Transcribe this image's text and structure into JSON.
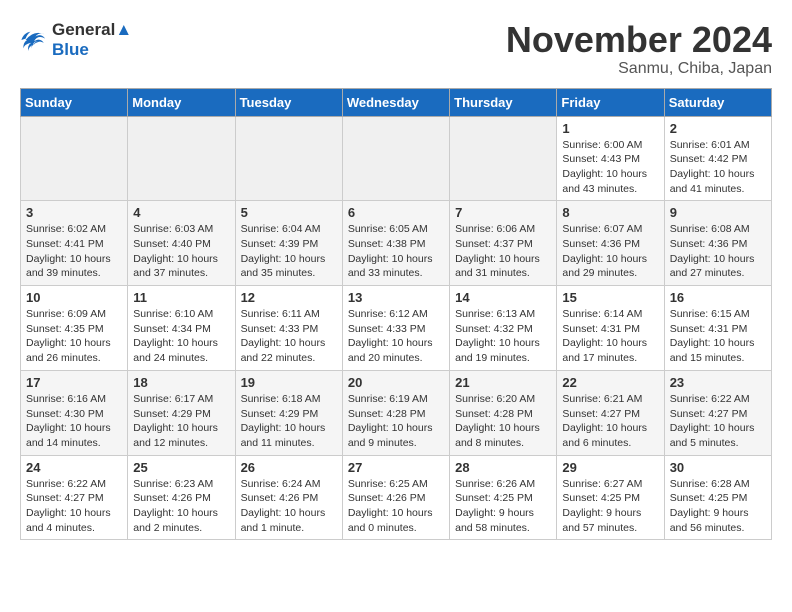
{
  "logo": {
    "line1": "General",
    "line2": "Blue"
  },
  "title": "November 2024",
  "location": "Sanmu, Chiba, Japan",
  "weekdays": [
    "Sunday",
    "Monday",
    "Tuesday",
    "Wednesday",
    "Thursday",
    "Friday",
    "Saturday"
  ],
  "weeks": [
    [
      {
        "day": "",
        "empty": true
      },
      {
        "day": "",
        "empty": true
      },
      {
        "day": "",
        "empty": true
      },
      {
        "day": "",
        "empty": true
      },
      {
        "day": "",
        "empty": true
      },
      {
        "day": "1",
        "sunrise": "Sunrise: 6:00 AM",
        "sunset": "Sunset: 4:43 PM",
        "daylight": "Daylight: 10 hours and 43 minutes."
      },
      {
        "day": "2",
        "sunrise": "Sunrise: 6:01 AM",
        "sunset": "Sunset: 4:42 PM",
        "daylight": "Daylight: 10 hours and 41 minutes."
      }
    ],
    [
      {
        "day": "3",
        "sunrise": "Sunrise: 6:02 AM",
        "sunset": "Sunset: 4:41 PM",
        "daylight": "Daylight: 10 hours and 39 minutes."
      },
      {
        "day": "4",
        "sunrise": "Sunrise: 6:03 AM",
        "sunset": "Sunset: 4:40 PM",
        "daylight": "Daylight: 10 hours and 37 minutes."
      },
      {
        "day": "5",
        "sunrise": "Sunrise: 6:04 AM",
        "sunset": "Sunset: 4:39 PM",
        "daylight": "Daylight: 10 hours and 35 minutes."
      },
      {
        "day": "6",
        "sunrise": "Sunrise: 6:05 AM",
        "sunset": "Sunset: 4:38 PM",
        "daylight": "Daylight: 10 hours and 33 minutes."
      },
      {
        "day": "7",
        "sunrise": "Sunrise: 6:06 AM",
        "sunset": "Sunset: 4:37 PM",
        "daylight": "Daylight: 10 hours and 31 minutes."
      },
      {
        "day": "8",
        "sunrise": "Sunrise: 6:07 AM",
        "sunset": "Sunset: 4:36 PM",
        "daylight": "Daylight: 10 hours and 29 minutes."
      },
      {
        "day": "9",
        "sunrise": "Sunrise: 6:08 AM",
        "sunset": "Sunset: 4:36 PM",
        "daylight": "Daylight: 10 hours and 27 minutes."
      }
    ],
    [
      {
        "day": "10",
        "sunrise": "Sunrise: 6:09 AM",
        "sunset": "Sunset: 4:35 PM",
        "daylight": "Daylight: 10 hours and 26 minutes."
      },
      {
        "day": "11",
        "sunrise": "Sunrise: 6:10 AM",
        "sunset": "Sunset: 4:34 PM",
        "daylight": "Daylight: 10 hours and 24 minutes."
      },
      {
        "day": "12",
        "sunrise": "Sunrise: 6:11 AM",
        "sunset": "Sunset: 4:33 PM",
        "daylight": "Daylight: 10 hours and 22 minutes."
      },
      {
        "day": "13",
        "sunrise": "Sunrise: 6:12 AM",
        "sunset": "Sunset: 4:33 PM",
        "daylight": "Daylight: 10 hours and 20 minutes."
      },
      {
        "day": "14",
        "sunrise": "Sunrise: 6:13 AM",
        "sunset": "Sunset: 4:32 PM",
        "daylight": "Daylight: 10 hours and 19 minutes."
      },
      {
        "day": "15",
        "sunrise": "Sunrise: 6:14 AM",
        "sunset": "Sunset: 4:31 PM",
        "daylight": "Daylight: 10 hours and 17 minutes."
      },
      {
        "day": "16",
        "sunrise": "Sunrise: 6:15 AM",
        "sunset": "Sunset: 4:31 PM",
        "daylight": "Daylight: 10 hours and 15 minutes."
      }
    ],
    [
      {
        "day": "17",
        "sunrise": "Sunrise: 6:16 AM",
        "sunset": "Sunset: 4:30 PM",
        "daylight": "Daylight: 10 hours and 14 minutes."
      },
      {
        "day": "18",
        "sunrise": "Sunrise: 6:17 AM",
        "sunset": "Sunset: 4:29 PM",
        "daylight": "Daylight: 10 hours and 12 minutes."
      },
      {
        "day": "19",
        "sunrise": "Sunrise: 6:18 AM",
        "sunset": "Sunset: 4:29 PM",
        "daylight": "Daylight: 10 hours and 11 minutes."
      },
      {
        "day": "20",
        "sunrise": "Sunrise: 6:19 AM",
        "sunset": "Sunset: 4:28 PM",
        "daylight": "Daylight: 10 hours and 9 minutes."
      },
      {
        "day": "21",
        "sunrise": "Sunrise: 6:20 AM",
        "sunset": "Sunset: 4:28 PM",
        "daylight": "Daylight: 10 hours and 8 minutes."
      },
      {
        "day": "22",
        "sunrise": "Sunrise: 6:21 AM",
        "sunset": "Sunset: 4:27 PM",
        "daylight": "Daylight: 10 hours and 6 minutes."
      },
      {
        "day": "23",
        "sunrise": "Sunrise: 6:22 AM",
        "sunset": "Sunset: 4:27 PM",
        "daylight": "Daylight: 10 hours and 5 minutes."
      }
    ],
    [
      {
        "day": "24",
        "sunrise": "Sunrise: 6:22 AM",
        "sunset": "Sunset: 4:27 PM",
        "daylight": "Daylight: 10 hours and 4 minutes."
      },
      {
        "day": "25",
        "sunrise": "Sunrise: 6:23 AM",
        "sunset": "Sunset: 4:26 PM",
        "daylight": "Daylight: 10 hours and 2 minutes."
      },
      {
        "day": "26",
        "sunrise": "Sunrise: 6:24 AM",
        "sunset": "Sunset: 4:26 PM",
        "daylight": "Daylight: 10 hours and 1 minute."
      },
      {
        "day": "27",
        "sunrise": "Sunrise: 6:25 AM",
        "sunset": "Sunset: 4:26 PM",
        "daylight": "Daylight: 10 hours and 0 minutes."
      },
      {
        "day": "28",
        "sunrise": "Sunrise: 6:26 AM",
        "sunset": "Sunset: 4:25 PM",
        "daylight": "Daylight: 9 hours and 58 minutes."
      },
      {
        "day": "29",
        "sunrise": "Sunrise: 6:27 AM",
        "sunset": "Sunset: 4:25 PM",
        "daylight": "Daylight: 9 hours and 57 minutes."
      },
      {
        "day": "30",
        "sunrise": "Sunrise: 6:28 AM",
        "sunset": "Sunset: 4:25 PM",
        "daylight": "Daylight: 9 hours and 56 minutes."
      }
    ]
  ]
}
